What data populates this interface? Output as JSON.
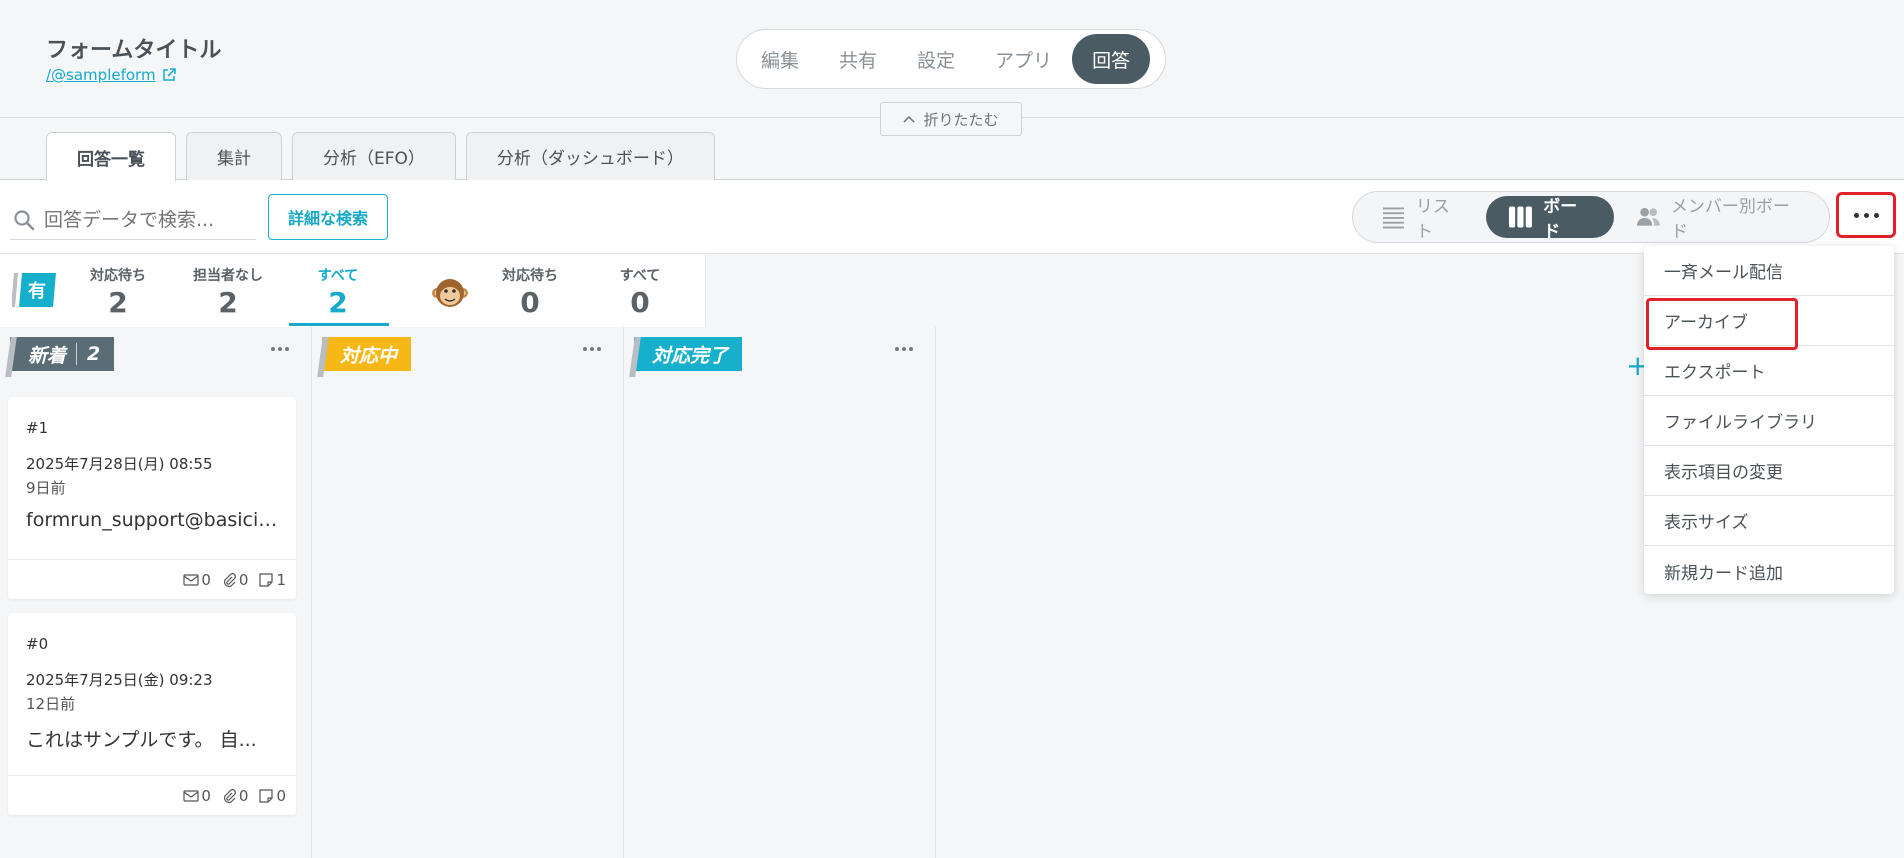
{
  "header": {
    "form_title": "フォームタイトル",
    "form_link": "/@sampleform",
    "nav": [
      "編集",
      "共有",
      "設定",
      "アプリ",
      "回答"
    ],
    "collapse_label": "折りたたむ"
  },
  "tabs": [
    "回答一覧",
    "集計",
    "分析（EFO）",
    "分析（ダッシュボード）"
  ],
  "toolbar": {
    "search_placeholder": "回答データで検索...",
    "advanced_search": "詳細な検索",
    "views": [
      "リスト",
      "ボード",
      "メンバー別ボード"
    ]
  },
  "stats": {
    "badge": "有",
    "items": [
      {
        "label": "対応待ち",
        "value": "2"
      },
      {
        "label": "担当者なし",
        "value": "2"
      },
      {
        "label": "すべて",
        "value": "2"
      },
      {
        "label": "対応待ち",
        "value": "0"
      },
      {
        "label": "すべて",
        "value": "0"
      }
    ]
  },
  "columns": [
    {
      "label": "新着",
      "count": "2",
      "color": "#5a6c75"
    },
    {
      "label": "対応中",
      "color": "#f7b716"
    },
    {
      "label": "対応完了",
      "color": "#17b0cc"
    }
  ],
  "cards": [
    {
      "no": "#1",
      "date": "2025年7月28日(月) 08:55",
      "ago": "9日前",
      "body": "formrun_support@basicinc...",
      "mail": "0",
      "attach": "0",
      "notes": "1"
    },
    {
      "no": "#0",
      "date": "2025年7月25日(金) 09:23",
      "ago": "12日前",
      "body": "これはサンプルです。 自...",
      "mail": "0",
      "attach": "0",
      "notes": "0"
    }
  ],
  "menu": [
    "一斉メール配信",
    "アーカイブ",
    "エクスポート",
    "ファイルライブラリ",
    "表示項目の変更",
    "表示サイズ",
    "新規カード追加"
  ],
  "colors": {
    "accent": "#17aacb",
    "highlight": "#e0202a",
    "dark": "#4b5b63"
  }
}
